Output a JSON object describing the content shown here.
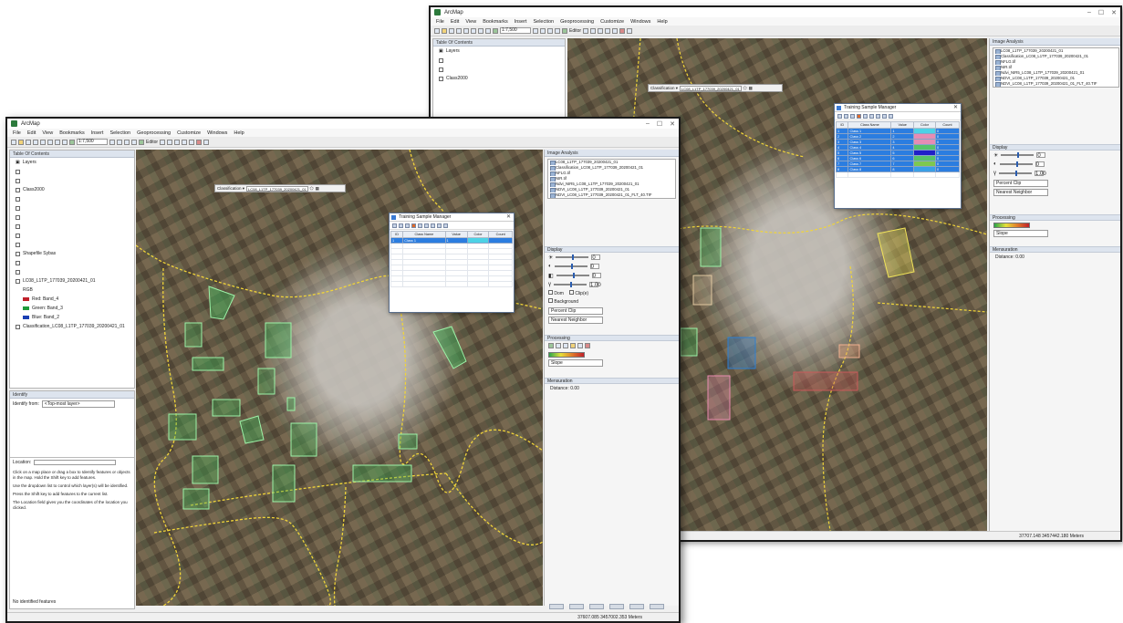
{
  "window": {
    "title": "ArcMap",
    "window_controls": [
      "–",
      "☐",
      "✕"
    ]
  },
  "menu": [
    "File",
    "Edit",
    "View",
    "Bookmarks",
    "Insert",
    "Selection",
    "Geoprocessing",
    "Customize",
    "Windows",
    "Help"
  ],
  "toolbar": {
    "scale_value": "1:7,500",
    "selection_label": "Editor"
  },
  "toc": {
    "title": "Table Of Contents",
    "root": "Layers",
    "items": [
      {
        "label": ""
      },
      {
        "label": ""
      },
      {
        "label": "Class2000"
      },
      {
        "label": ""
      },
      {
        "label": ""
      },
      {
        "label": ""
      },
      {
        "label": ""
      },
      {
        "label": ""
      },
      {
        "label": ""
      },
      {
        "label": "Shapefile Sybas"
      },
      {
        "label": ""
      },
      {
        "label": ""
      },
      {
        "label": "LC08_L1TP_177039_20200421_01"
      },
      {
        "label": "RGB"
      },
      {
        "label": "Red: Band_4"
      },
      {
        "label": "Green: Band_3"
      },
      {
        "label": "Blue: Band_2"
      },
      {
        "label": "Classification_LC08_L1TP_177039_20200421_01"
      }
    ],
    "band_colors": {
      "red": "#c0202a",
      "green": "#1f9a3a",
      "blue": "#1a3fb3"
    }
  },
  "identify": {
    "title": "Identify",
    "identify_from_label": "Identify from:",
    "identify_from_value": "<Top-most layer>"
  },
  "location": {
    "label": "Location:",
    "help_lines": [
      "Click on a map place or drag a box to Identify features or objects in the map. Hold the Shift key to add features.",
      "Use the dropdown list to control which layer(s) will be identified.",
      "Press the Shift key to add features to the current list.",
      "The Location field gives you the coordinates of the location you clicked."
    ],
    "footer": "No identified features"
  },
  "classification_toolbar": {
    "label": "Classification ▾",
    "layer": "LC08_L1TP_177039_20200421_01"
  },
  "training_manager": {
    "title": "Training Sample Manager",
    "columns": [
      "ID",
      "Class Name",
      "Value",
      "Color",
      "Count"
    ],
    "front_rows": [
      {
        "id": "1",
        "name": "Class 1",
        "value": "1",
        "color": "#4dd2e6",
        "count": ""
      }
    ],
    "back_rows": [
      {
        "id": "1",
        "name": "Class 1",
        "value": "1",
        "color": "#4dd2e6",
        "count": "0"
      },
      {
        "id": "2",
        "name": "Class 2",
        "value": "2",
        "color": "#e68cb4",
        "count": "0"
      },
      {
        "id": "3",
        "name": "Class 3",
        "value": "3",
        "color": "#e68cb4",
        "count": "0"
      },
      {
        "id": "4",
        "name": "Class 4",
        "value": "4",
        "color": "#57c36a",
        "count": "0"
      },
      {
        "id": "5",
        "name": "Class 5",
        "value": "5",
        "color": "#2020c8",
        "count": "0"
      },
      {
        "id": "6",
        "name": "Class 6",
        "value": "6",
        "color": "#57c36a",
        "count": "0"
      },
      {
        "id": "7",
        "name": "Class 7",
        "value": "7",
        "color": "#7ec850",
        "count": "0"
      },
      {
        "id": "8",
        "name": "Class 8",
        "value": "8",
        "color": "#3aa0e6",
        "count": "0"
      }
    ]
  },
  "image_analysis": {
    "title": "Image Analysis",
    "layers": [
      "LC08_L1TP_177039_20200421_01",
      "Classification_LC08_L1TP_177039_20200421_01",
      "NFLG.tif",
      "NIR.tif",
      "Ndvi_NIR5_LC08_L1TP_177039_20200421_01",
      "NDVI_LC08_L1TP_177039_20200421_01",
      "NDVI_LC08_L1TP_177039_20200421_01_FLT_40.TIF"
    ],
    "display_title": "Display",
    "contrast_values": [
      "0",
      "0",
      "0",
      "1.00"
    ],
    "checkbox_labels": [
      "Dom",
      "Clip(e)",
      "Background"
    ],
    "stretch_value": "Percent Clip",
    "resample_value": "Nearest Neighbor",
    "processing_title": "Processing",
    "ramp_name": "Slope",
    "mensuration_title": "Mensuration",
    "mensuration_value": "Distance: 0.00",
    "status": "37607.085   3457002.353 Meters"
  },
  "status_back": "37707.148   3457442.180 Meters",
  "colors": {
    "aoi_fill": "#3fb65a",
    "aoi_stroke": "#9df2a8",
    "boundary": "#f0d43a",
    "sample_blue": "#2e7fd1",
    "sample_red": "#c85a5a",
    "sample_pink": "#e98cb0",
    "sample_yellow": "#f0e35a"
  },
  "icons": [
    "app-icon",
    "close-icon",
    "layers-icon",
    "polygon-tool-icon"
  ]
}
